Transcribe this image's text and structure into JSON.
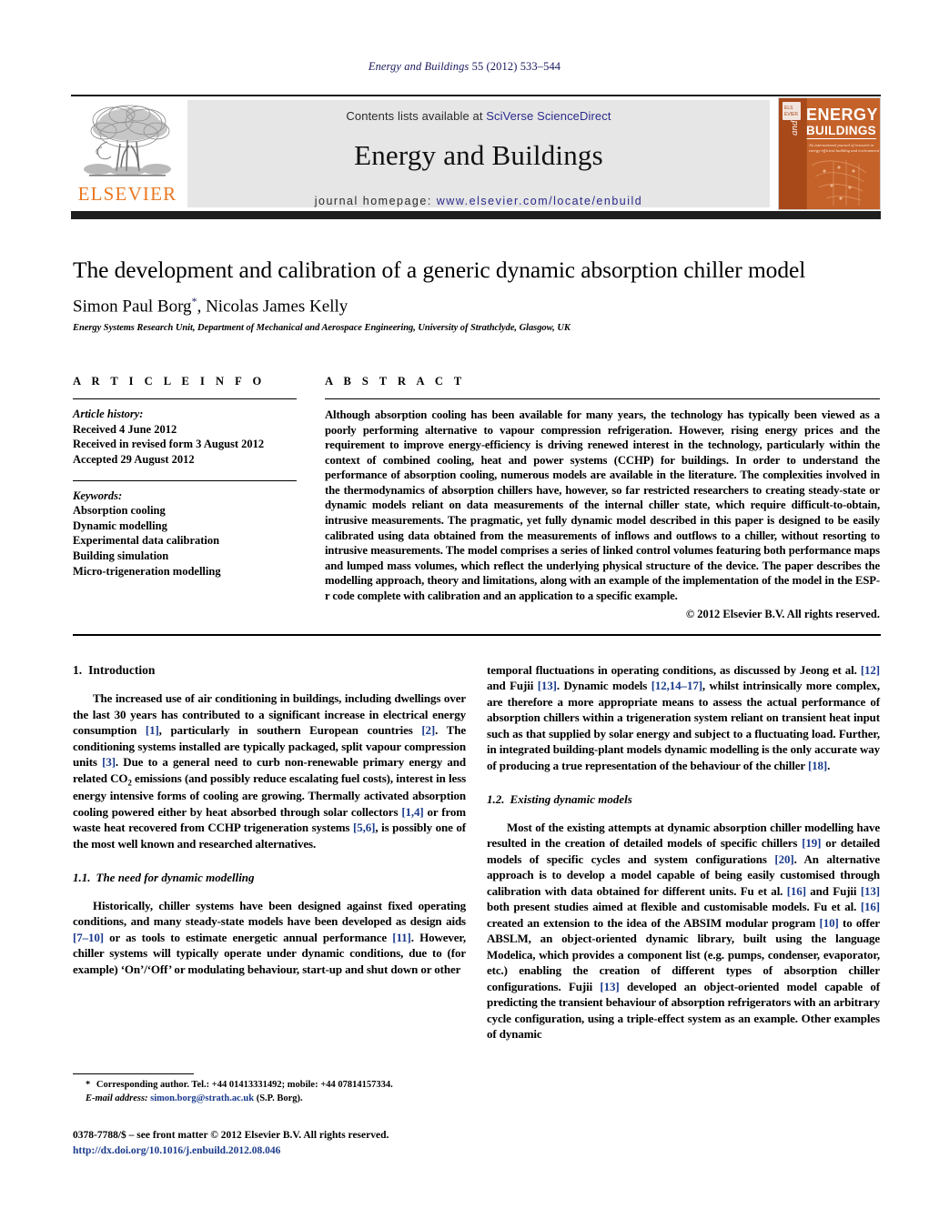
{
  "running_head": {
    "journal": "Energy and Buildings",
    "volume_info": " 55 (2012) 533–544"
  },
  "header": {
    "publisher_logo_text": "ELSEVIER",
    "contents_prefix": "Contents lists available at ",
    "contents_link": "SciVerse ScienceDirect",
    "journal_title": "Energy and Buildings",
    "homepage_prefix": "journal homepage: ",
    "homepage_link": "www.elsevier.com/locate/enbuild",
    "cover": {
      "line1": "ENERGY",
      "line2": "and",
      "line3": "BUILDINGS",
      "subtitle": "An international journal of research in energy-efficient\nbuilding and environment",
      "bg_color": "#b9571f",
      "panel_color": "#d4762f"
    },
    "accent_color": "#e87722",
    "link_color": "#2b2b8c"
  },
  "article": {
    "title": "The development and calibration of a generic dynamic absorption chiller model",
    "authors": "Simon Paul Borg",
    "authors_marker": "*",
    "authors_rest": ", Nicolas James Kelly",
    "affiliation": "Energy Systems Research Unit, Department of Mechanical and Aerospace Engineering, University of Strathclyde, Glasgow, UK"
  },
  "article_info": {
    "heading": "A R T I C L E   I N F O",
    "history_label": "Article history:",
    "history": [
      "Received 4 June 2012",
      "Received in revised form 3 August 2012",
      "Accepted 29 August 2012"
    ],
    "keywords_label": "Keywords:",
    "keywords": [
      "Absorption cooling",
      "Dynamic modelling",
      "Experimental data calibration",
      "Building simulation",
      "Micro-trigeneration modelling"
    ]
  },
  "abstract": {
    "heading": "A B S T R A C T",
    "text": "Although absorption cooling has been available for many years, the technology has typically been viewed as a poorly performing alternative to vapour compression refrigeration. However, rising energy prices and the requirement to improve energy-efficiency is driving renewed interest in the technology, particularly within the context of combined cooling, heat and power systems (CCHP) for buildings. In order to understand the performance of absorption cooling, numerous models are available in the literature. The complexities involved in the thermodynamics of absorption chillers have, however, so far restricted researchers to creating steady-state or dynamic models reliant on data measurements of the internal chiller state, which require difficult-to-obtain, intrusive measurements. The pragmatic, yet fully dynamic model described in this paper is designed to be easily calibrated using data obtained from the measurements of inflows and outflows to a chiller, without resorting to intrusive measurements. The model comprises a series of linked control volumes featuring both performance maps and lumped mass volumes, which reflect the underlying physical structure of the device. The paper describes the modelling approach, theory and limitations, along with an example of the implementation of the model in the ESP-r code complete with calibration and an application to a specific example.",
    "copyright": "© 2012 Elsevier B.V. All rights reserved."
  },
  "body": {
    "section1": {
      "number": "1.",
      "title": "Introduction",
      "paragraph1_a": "The increased use of air conditioning in buildings, including dwellings over the last 30 years has contributed to a significant increase in electrical energy consumption ",
      "ref1": "[1]",
      "paragraph1_b": ", particularly in southern European countries ",
      "ref2": "[2]",
      "paragraph1_c": ". The conditioning systems installed are typically packaged, split vapour compression units ",
      "ref3": "[3]",
      "paragraph1_d": ". Due to a general need to curb non-renewable primary energy and related CO",
      "sub2": "2",
      "paragraph1_e": " emissions (and possibly reduce escalating fuel costs), interest in less energy intensive forms of cooling are growing. Thermally activated absorption cooling powered either by heat absorbed through solar collectors ",
      "ref4": "[1,4]",
      "paragraph1_f": " or from waste heat recovered from CCHP trigeneration systems ",
      "ref5": "[5,6]",
      "paragraph1_g": ", is possibly one of the most well known and researched alternatives."
    },
    "section1_1": {
      "number": "1.1.",
      "title": "The need for dynamic modelling",
      "para_a": "Historically, chiller systems have been designed against fixed operating conditions, and many steady-state models have been developed as design aids ",
      "ref1": "[7–10]",
      "para_b": " or as tools to estimate energetic annual performance ",
      "ref2": "[11]",
      "para_c": ". However, chiller systems will typically operate under dynamic conditions, due to (for example) ‘On’/‘Off’ or modulating behaviour, start-up and shut down or other "
    },
    "right_continuation": {
      "para_a": "temporal fluctuations in operating conditions, as discussed by Jeong et al. ",
      "ref1": "[12]",
      "para_b": " and Fujii ",
      "ref2": "[13]",
      "para_c": ". Dynamic models ",
      "ref3": "[12,14–17]",
      "para_d": ", whilst intrinsically more complex, are therefore a more appropriate means to assess the actual performance of absorption chillers within a trigeneration system reliant on transient heat input such as that supplied by solar energy and subject to a fluctuating load. Further, in integrated building-plant models dynamic modelling is the only accurate way of producing a true representation of the behaviour of the chiller ",
      "ref4": "[18]",
      "para_e": "."
    },
    "section1_2": {
      "number": "1.2.",
      "title": "Existing dynamic models",
      "para_a": "Most of the existing attempts at dynamic absorption chiller modelling have resulted in the creation of detailed models of specific chillers ",
      "ref1": "[19]",
      "para_b": " or detailed models of specific cycles and system configurations ",
      "ref2": "[20]",
      "para_c": ". An alternative approach is to develop a model capable of being easily customised through calibration with data obtained for different units. Fu et al. ",
      "ref3": "[16]",
      "para_d": " and Fujii ",
      "ref4": "[13]",
      "para_e": " both present studies aimed at flexible and customisable models. Fu et al. ",
      "ref5": "[16]",
      "para_f": " created an extension to the idea of the ABSIM modular program ",
      "ref6": "[10]",
      "para_g": " to offer ABSLM, an object-oriented dynamic library, built using the language Modelica, which provides a component list (e.g. pumps, condenser, evaporator, etc.) enabling the creation of different types of absorption chiller configurations. Fujii ",
      "ref7": "[13]",
      "para_h": " developed an object-oriented model capable of predicting the transient behaviour of absorption refrigerators with an arbitrary cycle configuration, using a triple-effect system as an example. Other examples of dynamic"
    }
  },
  "footnote": {
    "marker": "*",
    "line1": " Corresponding author. Tel.: +44 01413331492; mobile: +44 07814157334.",
    "email_label": "E-mail address:",
    "email": " simon.borg@strath.ac.uk",
    "email_suffix": " (S.P. Borg)."
  },
  "footer": {
    "issn_line": "0378-7788/$ – see front matter © 2012 Elsevier B.V. All rights reserved.",
    "doi": "http://dx.doi.org/10.1016/j.enbuild.2012.08.046"
  }
}
